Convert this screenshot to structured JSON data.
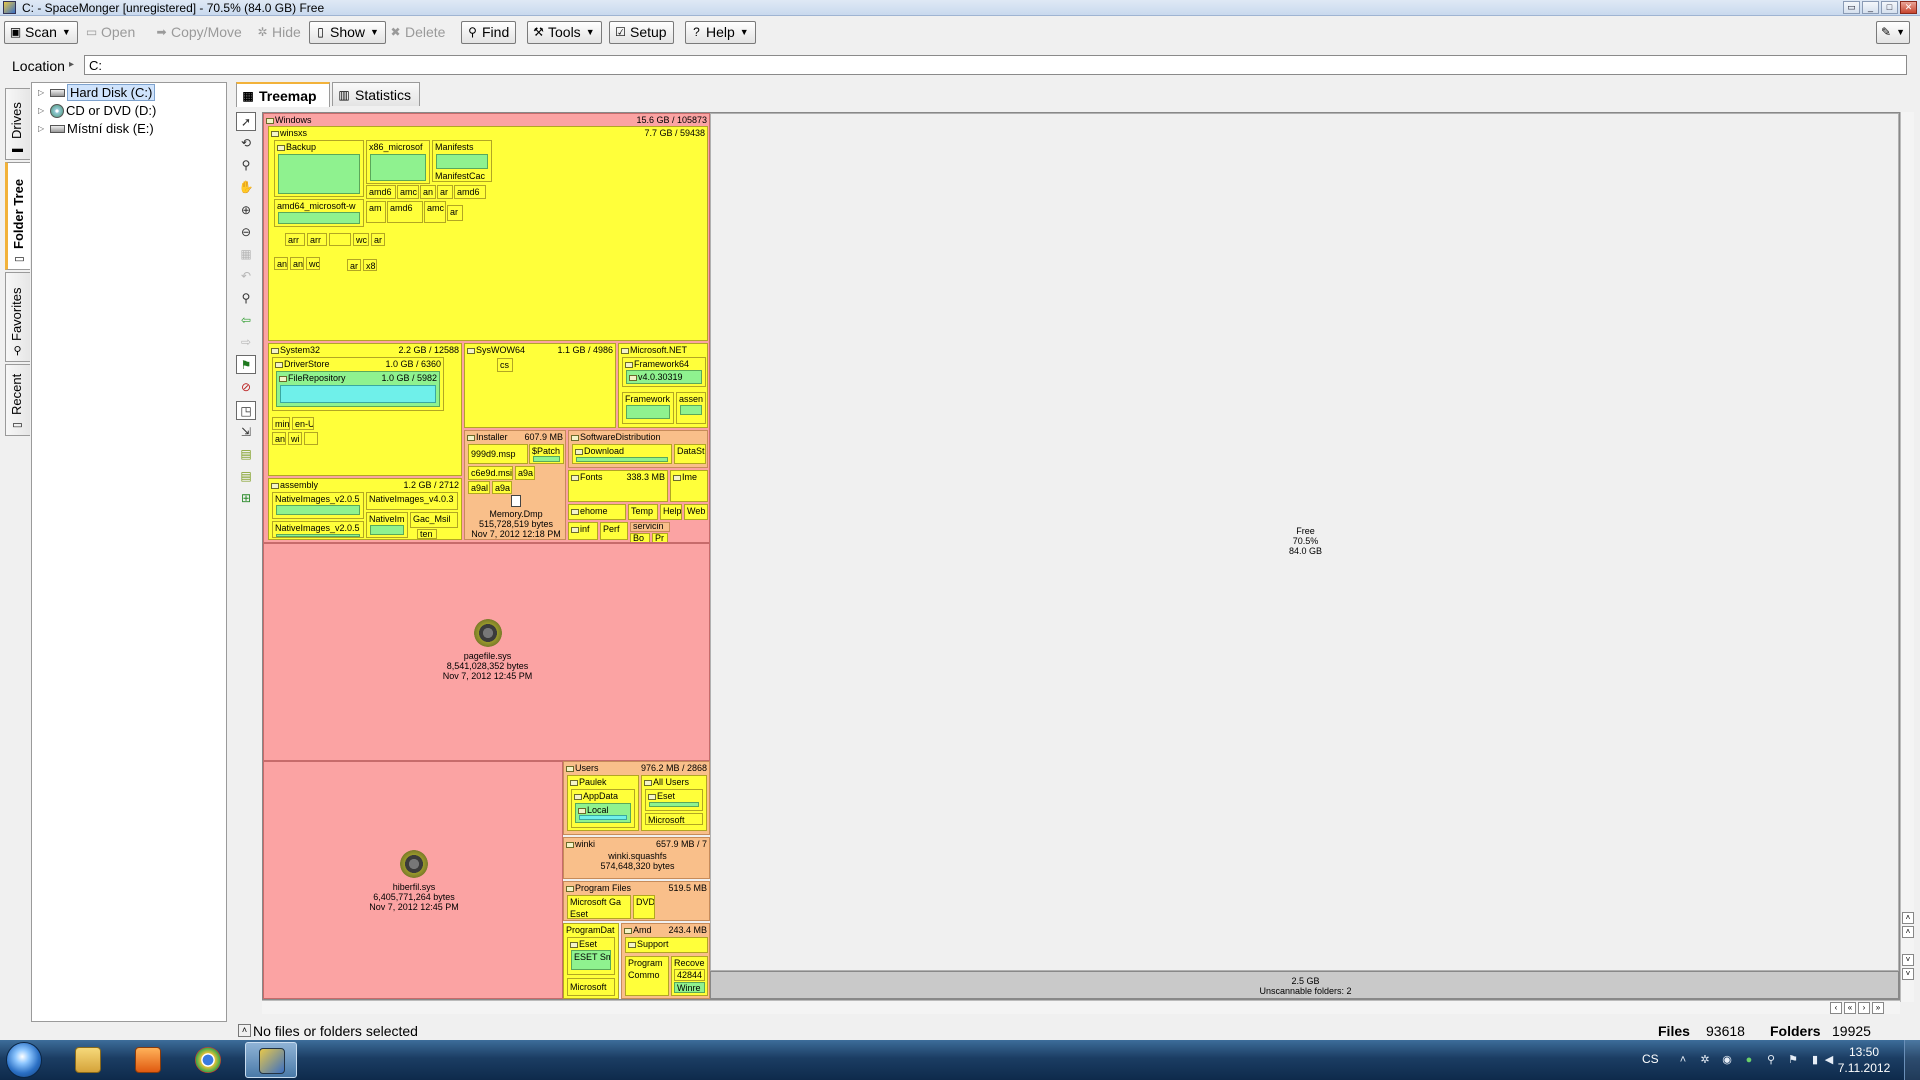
{
  "window": {
    "title": "C: - SpaceMonger [unregistered] - 70.5% (84.0 GB) Free",
    "controls": {
      "restore": "▭",
      "minimize": "_",
      "maximize": "□",
      "close": "✕"
    }
  },
  "toolbar": {
    "scan": "Scan",
    "open": "Open",
    "copymove": "Copy/Move",
    "hide": "Hide",
    "show": "Show",
    "delete": "Delete",
    "find": "Find",
    "tools": "Tools",
    "setup": "Setup",
    "help": "Help"
  },
  "location": {
    "label": "Location",
    "value": "C:"
  },
  "side_tabs": {
    "drives": "Drives",
    "folder_tree": "Folder Tree",
    "favorites": "Favorites",
    "recent": "Recent"
  },
  "tree": {
    "items": [
      {
        "label": "Hard Disk (C:)"
      },
      {
        "label": "CD or DVD (D:)"
      },
      {
        "label": "Místní disk (E:)"
      }
    ]
  },
  "tabs": {
    "treemap": "Treemap",
    "statistics": "Statistics"
  },
  "treemap": {
    "windows": {
      "name": "Windows",
      "size": "15.6 GB / 105873"
    },
    "winsxs": {
      "name": "winsxs",
      "size": "7.7 GB / 59438"
    },
    "backup": "Backup",
    "x86": "x86_microsof",
    "manifests": "Manifests",
    "manifestcache": "ManifestCac",
    "amd64": "amd64_microsoft-w",
    "small_amd": [
      "amd6",
      "amc",
      "an",
      "ar",
      "amd6"
    ],
    "small_row2": [
      "am",
      "amd6",
      "amc",
      "ar"
    ],
    "small_row3": [
      "arr",
      "arr",
      "wc",
      "ar"
    ],
    "small_row4": [
      "an",
      "an",
      "wc",
      "ar",
      "x8"
    ],
    "system32": {
      "name": "System32",
      "size": "2.2 GB / 12588"
    },
    "driverstore": {
      "name": "DriverStore",
      "size": "1.0 GB / 6360"
    },
    "filerepository": {
      "name": "FileRepository",
      "size": "1.0 GB / 5982"
    },
    "sys32_small": [
      "min",
      "en-U",
      "an",
      "wi"
    ],
    "syswow64": {
      "name": "SysWOW64",
      "size": "1.1 GB / 4986"
    },
    "syswow_small": "cs",
    "dotnet": "Microsoft.NET",
    "framework64": "Framework64",
    "v4": "v4.0.30319",
    "framework": "Framework",
    "assem": "assen",
    "installer": {
      "name": "Installer",
      "size": "607.9 MB"
    },
    "msp": "999d9.msp",
    "patch": "$Patch",
    "msi": "c6e9d.msi",
    "a9a": [
      "a9a",
      "a9al",
      "a9a"
    ],
    "memorydmp": {
      "name": "Memory.Dmp",
      "bytes": "515,728,519 bytes",
      "date": "Nov 7, 2012 12:18 PM"
    },
    "softdist": "SoftwareDistribution",
    "download": "Download",
    "datast": "DataSt",
    "fonts": {
      "name": "Fonts",
      "size": "338.3 MB"
    },
    "ime": "Ime",
    "ehome": "ehome",
    "temp": "Temp",
    "help": "Help",
    "web": "Web",
    "inf": "inf",
    "perf": "Perf",
    "servicing": "servicin",
    "bo": "Bo",
    "pr": "Pr",
    "assembly": {
      "name": "assembly",
      "size": "1.2 GB / 2712"
    },
    "nativeimages1": "NativeImages_v2.0.5",
    "nativeimages2": "NativeImages_v4.0.3",
    "nativeimages3": "NativeImages_v2.0.5",
    "nativeim": "NativeIm",
    "gacmsil": "Gac_Msil",
    "temp2": "ten",
    "pagefile": {
      "name": "pagefile.sys",
      "bytes": "8,541,028,352 bytes",
      "date": "Nov 7, 2012 12:45 PM"
    },
    "hiberfil": {
      "name": "hiberfil.sys",
      "bytes": "6,405,771,264 bytes",
      "date": "Nov 7, 2012 12:45 PM"
    },
    "users": {
      "name": "Users",
      "size": "976.2 MB / 2868"
    },
    "paulek": "Paulek",
    "allusers": "All Users",
    "appdata": "AppData",
    "local": "Local",
    "eset": "Eset",
    "microsoft_u": "Microsoft",
    "winki": {
      "name": "winki",
      "size": "657.9 MB / 7"
    },
    "winkisquash": {
      "name": "winki.squashfs",
      "bytes": "574,648,320 bytes"
    },
    "programfiles": {
      "name": "Program Files",
      "size": "519.5 MB"
    },
    "msga": "Microsoft Ga",
    "dvd": "DVD",
    "eset_pf": "Eset",
    "programdata": "ProgramDat",
    "eset_pd": "Eset",
    "esetsm": "ESET Sm",
    "microsoft_pd": "Microsoft",
    "amd": {
      "name": "Amd",
      "size": "243.4 MB"
    },
    "support": "Support",
    "program": "Program",
    "common": "Commo",
    "recovery": "Recove",
    "r428": "42844",
    "winre": "Winre",
    "free": {
      "name": "Free",
      "percent": "70.5%",
      "size": "84.0 GB"
    },
    "unscannable": {
      "size": "2.5 GB",
      "label": "Unscannable folders: 2"
    }
  },
  "status": {
    "message": "No files or folders selected",
    "files_label": "Files",
    "files_value": "93618",
    "folders_label": "Folders",
    "folders_value": "19925"
  },
  "taskbar": {
    "lang": "CS",
    "time": "13:50",
    "date": "7.11.2012"
  },
  "colors": {
    "windows": "#fba3a3",
    "folder_yellow": "#ffff3a",
    "folder_green": "#8ff28f",
    "folder_peach": "#f9bf8a",
    "folder_cyan": "#6ff0ea",
    "free_space": "#f0f0f0"
  }
}
